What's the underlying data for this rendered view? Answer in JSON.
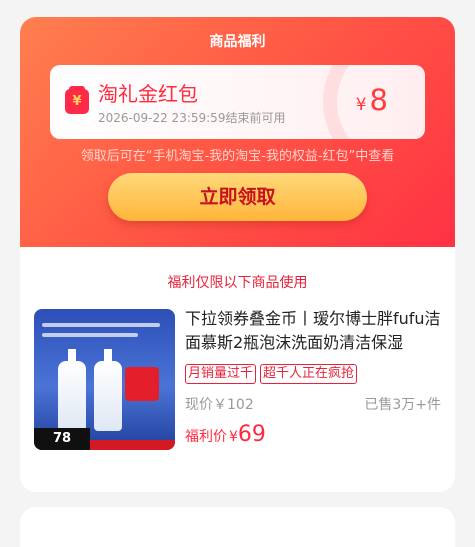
{
  "header": {
    "title": "商品福利"
  },
  "coupon": {
    "icon": "red-envelope-icon",
    "name": "淘礼金红包",
    "expiry": "2026-09-22 23:59:59结束前可用",
    "currency": "¥",
    "amount": "8"
  },
  "hint": "领取后可在“手机淘宝-我的淘宝-我的权益-红包”中查看",
  "claim_button": "立即领取",
  "section_title": "福利仅限以下商品使用",
  "product": {
    "thumb_price": "78",
    "title": "下拉领券叠金币丨瑷尔博士胖fufu洁面慕斯2瓶泡沫洗面奶清洁保湿",
    "tags": [
      "月销量过千",
      "超千人正在疯抢"
    ],
    "current_price": "现价￥102",
    "sold": "已售3万+件",
    "benefit_label": "福利价",
    "benefit_currency": "¥",
    "benefit_price": "69"
  },
  "colors": {
    "accent": "#ff2a3d",
    "button": "#ffb53a",
    "hero_start": "#ff7f4f",
    "hero_end": "#ff3144"
  }
}
